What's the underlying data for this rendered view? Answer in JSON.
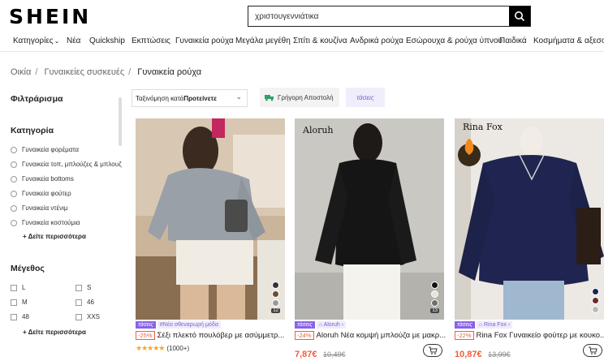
{
  "header": {
    "logo": "SHEIN",
    "search_value": "χριστουγεννιάτικα"
  },
  "nav": [
    "Κατηγορίες",
    "Νέα",
    "Quickship",
    "Εκπτώσεις",
    "Γυναικεία ρούχα",
    "Μεγάλα μεγέθη",
    "Σπίτι & κουζίνα",
    "Ανδρικά ρούχα",
    "Εσώρουχα & ρούχα ύπνου",
    "Παιδικά",
    "Κοσμήματα & αξεσουάρ"
  ],
  "breadcrumb": [
    "Οικία",
    "Γυναικείες συσκευές",
    "Γυναικεία ρούχα"
  ],
  "filters": {
    "title": "Φιλτράρισμα",
    "category_title": "Κατηγορία",
    "categories": [
      "Γυναικεία φορέματα",
      "Γυναικεία τοπ, μπλούζες & μπλουζ",
      "Γυναικεία bottoms",
      "Γυναικεία φούτερ",
      "Γυναικεία ντένιμ",
      "Γυναικεία κοστούμια"
    ],
    "more_label": "Δείτε περισσότερα",
    "size_title": "Μέγεθος",
    "sizes": [
      "L",
      "S",
      "M",
      "46",
      "48",
      "XXS"
    ],
    "more_label_2": "Δείτε περισσότερα"
  },
  "toolbar": {
    "sort_label": "Ταξινόμηση κατά",
    "sort_value": "Προτείνετε",
    "fast_shipping": "Γρήγορη Αποστολή",
    "trends": "τάσεις"
  },
  "products": [
    {
      "brand": "",
      "tag": "τάσεις",
      "sub": "#Νέα σθεναρωρή μόδα",
      "discount": "-25%",
      "title": "Σέξι πλεκτό πουλόβερ με ασύμμετρ...",
      "rating": "(1000+)",
      "price": "",
      "old_price": "",
      "swatch_count": "12"
    },
    {
      "brand": "Aloruh",
      "tag": "τάσεις",
      "sub": "Aloruh",
      "discount": "-24%",
      "title": "Aloruh Νέα κομψή μπλούζα με μακρ...",
      "rating": "",
      "price": "7,87€",
      "old_price": "10,49€",
      "swatch_count": "13"
    },
    {
      "brand": "Rina Fox",
      "tag": "τάσεις",
      "sub": "Rina Fox",
      "discount": "-22%",
      "title": "Rina Fox Γυναικείο φούτερ με κουκο...",
      "rating": "",
      "price": "10,87€",
      "old_price": "13,99€",
      "swatch_count": ""
    }
  ],
  "colors": {
    "accent": "#f25c3b",
    "purple": "#8a63e8"
  }
}
